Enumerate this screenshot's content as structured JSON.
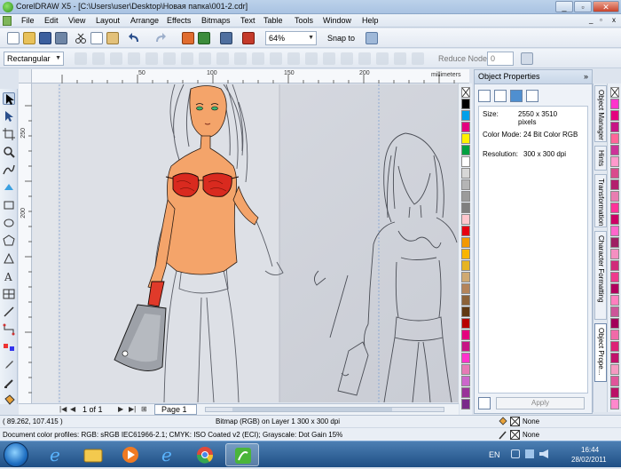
{
  "window": {
    "title": "CorelDRAW X5 - [C:\\Users\\user\\Desktop\\Новая папка\\001-2.cdr]",
    "controls": [
      "_",
      "▫",
      "✕"
    ],
    "doc_controls": [
      "_",
      "▫",
      "x"
    ]
  },
  "menu": [
    "File",
    "Edit",
    "View",
    "Layout",
    "Arrange",
    "Effects",
    "Bitmaps",
    "Text",
    "Table",
    "Tools",
    "Window",
    "Help"
  ],
  "toolbar": {
    "zoom": "64%",
    "snap_to": "Snap to"
  },
  "propbar": {
    "shape_mode": "Rectangular",
    "reduce_nodes": "Reduce Nodes",
    "reduce_value": "0"
  },
  "ruler": {
    "unit": "millimeters",
    "h_ticks": [
      "50",
      "100",
      "150",
      "200"
    ],
    "v_ticks": [
      "250",
      "200"
    ]
  },
  "page_nav": {
    "counter": "1 of 1",
    "tab": "Page 1"
  },
  "docker": {
    "title": "Object Properties",
    "size_label": "Size:",
    "size_value": "2550 x 3510",
    "size_unit": "pixels",
    "color_mode_label": "Color Mode:",
    "color_mode_value": "24 Bit Color  RGB",
    "resolution_label": "Resolution:",
    "resolution_value": "300 x 300 dpi",
    "apply": "Apply"
  },
  "side_tabs": [
    "Object Manager",
    "Hints",
    "Transformation",
    "Character Formatting",
    "Object Prope..."
  ],
  "palette": {
    "main": [
      "none",
      "#000000",
      "#00a0e9",
      "#e4007f",
      "#fff100",
      "#00a040",
      "#ffffff",
      "#d7d7d7",
      "#b5b5b5",
      "#9b9b9b",
      "#808080",
      "#ffc7ce",
      "#e60012",
      "#f39800",
      "#f8b500",
      "#e6b422",
      "#cfa972",
      "#b4845a",
      "#8c6239",
      "#603813",
      "#b80000",
      "#e4007f",
      "#c71585",
      "#ff33cc",
      "#e67ab6",
      "#cc66cc",
      "#993399",
      "#7a2a8a"
    ],
    "secondary": [
      "none",
      "#ff33cc",
      "#e4007f",
      "#c71585",
      "#ff6699",
      "#cc3399",
      "#ff99cc",
      "#d94a8c",
      "#b3206e",
      "#e87db1",
      "#ff3399",
      "#cc0066",
      "#ff66cc",
      "#9e1f63",
      "#f58fc1",
      "#d12b7a",
      "#ee3a8c",
      "#b1005e",
      "#ff7fbf",
      "#cc5599",
      "#a3005a",
      "#f06aa8",
      "#dd2277",
      "#c1126b",
      "#f49ac1",
      "#e0559a",
      "#bb1166",
      "#ff88cc"
    ]
  },
  "status": {
    "cursor": "( 89.262, 107.415 )",
    "object_info": "Bitmap (RGB) on Layer 1 300 x 300 dpi",
    "profiles": "Document color profiles: RGB: sRGB IEC61966-2.1; CMYK: ISO Coated v2 (ECI); Grayscale: Dot Gain 15%",
    "fill_none": "None",
    "outline_none": "None"
  },
  "taskbar": {
    "lang": "EN",
    "time": "16:44",
    "date": "28/02/2011"
  }
}
